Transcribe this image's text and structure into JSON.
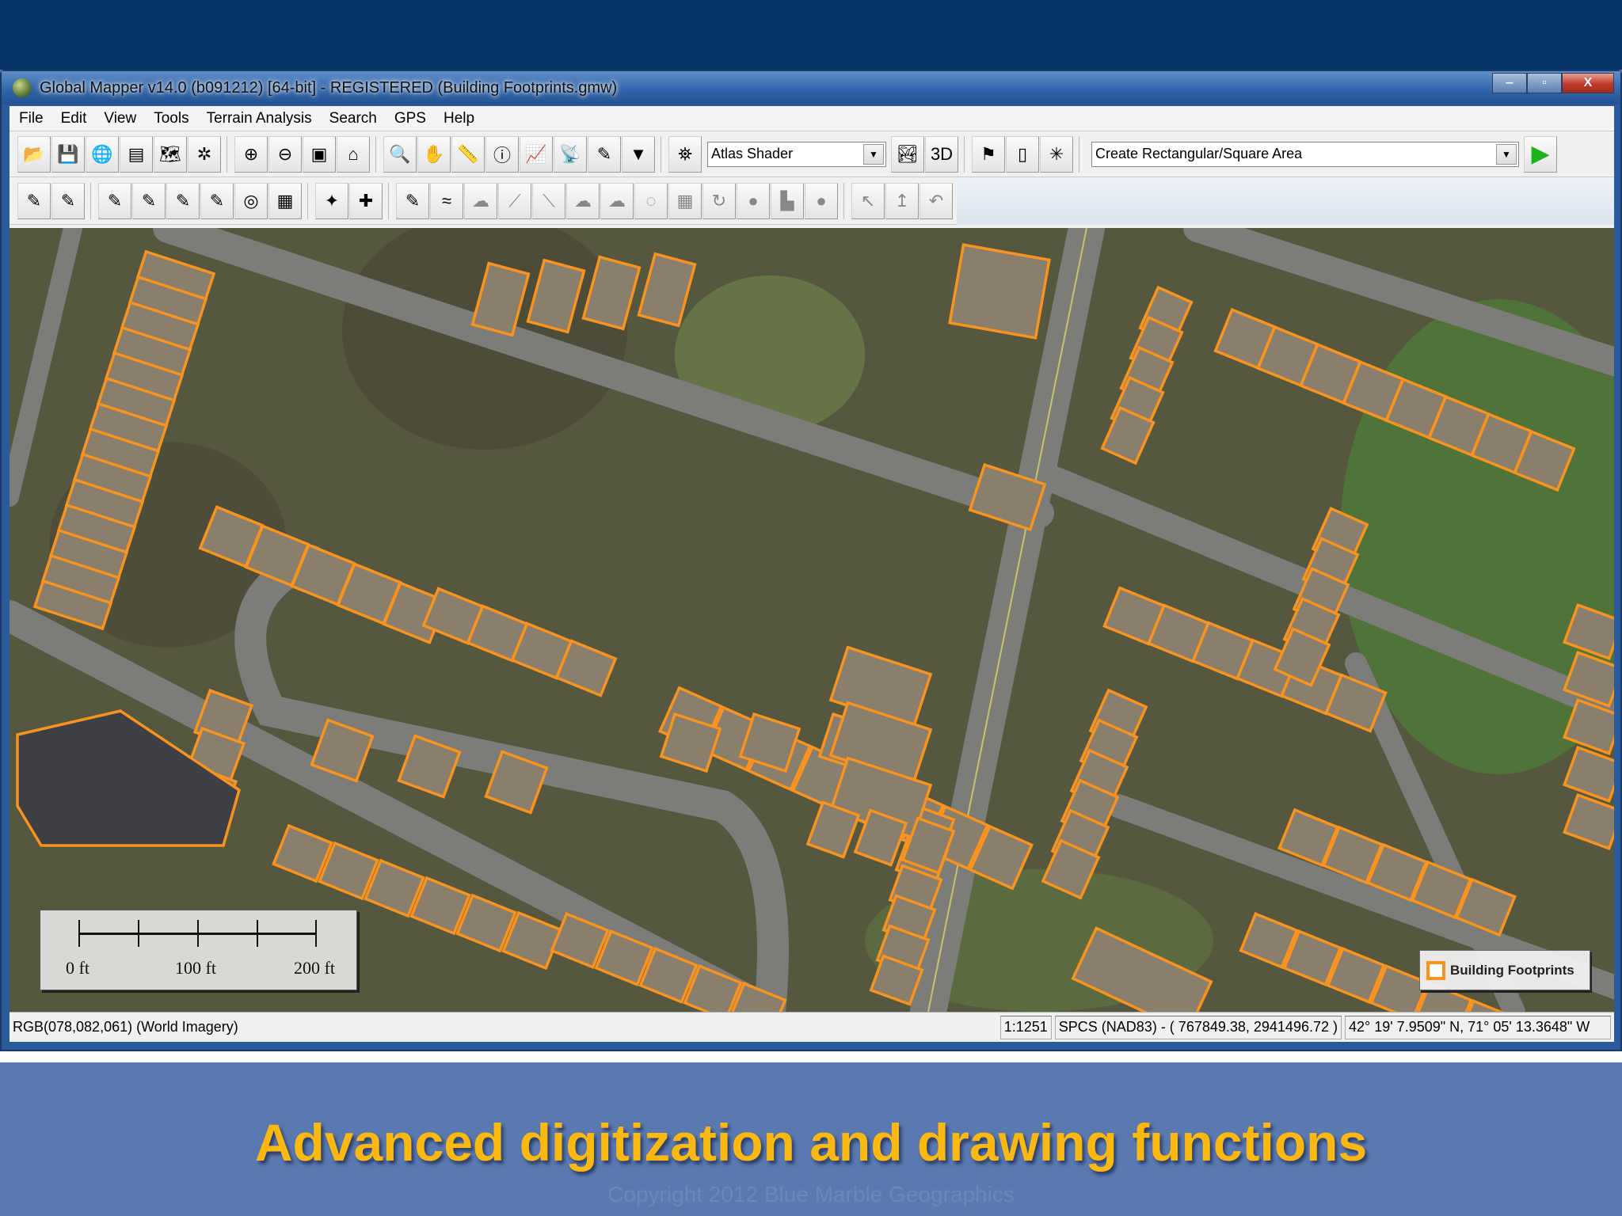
{
  "window": {
    "title": "Global Mapper v14.0 (b091212) [64-bit] - REGISTERED (Building Footprints.gmw)",
    "minimize": "‒",
    "maximize": "▫",
    "close": "X"
  },
  "menu": [
    "File",
    "Edit",
    "View",
    "Tools",
    "Terrain Analysis",
    "Search",
    "GPS",
    "Help"
  ],
  "toolbar1": {
    "group1": [
      {
        "icon": "open-folder-icon",
        "glyph": "📂"
      },
      {
        "icon": "save-icon",
        "glyph": "💾"
      },
      {
        "icon": "globe-icon",
        "glyph": "🌐"
      },
      {
        "icon": "control-center-icon",
        "glyph": "▤"
      },
      {
        "icon": "config-icon",
        "glyph": "🗺"
      },
      {
        "icon": "tools-icon",
        "glyph": "✲"
      }
    ],
    "group2": [
      {
        "icon": "zoom-in-icon",
        "glyph": "⊕"
      },
      {
        "icon": "zoom-out-icon",
        "glyph": "⊖"
      },
      {
        "icon": "zoom-to-layer-icon",
        "glyph": "▣"
      },
      {
        "icon": "home-icon",
        "glyph": "⌂"
      }
    ],
    "group3": [
      {
        "icon": "zoom-tool-icon",
        "glyph": "🔍"
      },
      {
        "icon": "pan-hand-icon",
        "glyph": "✋"
      },
      {
        "icon": "measure-icon",
        "glyph": "📏"
      },
      {
        "icon": "feature-info-icon",
        "glyph": "ⓘ"
      },
      {
        "icon": "path-profile-icon",
        "glyph": "📈"
      },
      {
        "icon": "view-shed-icon",
        "glyph": "📡"
      },
      {
        "icon": "digitizer-icon",
        "glyph": "✎"
      },
      {
        "icon": "filter-icon",
        "glyph": "▼"
      }
    ],
    "group4": [
      {
        "icon": "binoculars-icon",
        "glyph": "⛯"
      }
    ],
    "shader_select": "Atlas Shader",
    "group5": [
      {
        "icon": "3d-view-icon",
        "glyph": "🏞"
      },
      {
        "icon": "3d-icon",
        "glyph": "3D"
      }
    ],
    "group6": [
      {
        "icon": "gps-flag-icon",
        "glyph": "⚑"
      },
      {
        "icon": "gps-device-icon",
        "glyph": "▯"
      },
      {
        "icon": "gps-track-icon",
        "glyph": "✳"
      }
    ],
    "digitizer_mode_select": "Create Rectangular/Square Area",
    "go": "▶"
  },
  "toolbar2": [
    {
      "icon": "create-area-icon",
      "glyph": "✎"
    },
    {
      "icon": "create-line-icon",
      "glyph": "✎"
    },
    {
      "sep": true
    },
    {
      "icon": "create-stairs-icon",
      "glyph": "✎"
    },
    {
      "icon": "create-freehand-area-icon",
      "glyph": "✎"
    },
    {
      "icon": "create-rectangle-icon",
      "glyph": "✎"
    },
    {
      "icon": "create-range-ring-icon",
      "glyph": "✎"
    },
    {
      "icon": "create-circles-icon",
      "glyph": "◎"
    },
    {
      "icon": "create-grid-icon",
      "glyph": "▦"
    },
    {
      "sep": true
    },
    {
      "icon": "create-points-icon",
      "glyph": "✦"
    },
    {
      "icon": "create-line-point-icon",
      "glyph": "✚"
    },
    {
      "sep": true
    },
    {
      "icon": "edit-vertices-icon",
      "glyph": "✎"
    },
    {
      "icon": "smooth-line-icon",
      "glyph": "≈"
    },
    {
      "icon": "merge-areas-icon",
      "glyph": "☁",
      "gray": true
    },
    {
      "icon": "split-line-icon",
      "glyph": "⟋",
      "gray": true
    },
    {
      "icon": "join-line-icon",
      "glyph": "⟍",
      "gray": true
    },
    {
      "icon": "crop-area-icon",
      "glyph": "☁",
      "gray": true
    },
    {
      "icon": "combine-area-icon",
      "glyph": "☁",
      "gray": true
    },
    {
      "icon": "buffer-icon",
      "glyph": "◌",
      "gray": true
    },
    {
      "icon": "grid-area-icon",
      "glyph": "▦",
      "gray": true
    },
    {
      "icon": "rotate-area-icon",
      "glyph": "↻",
      "gray": true
    },
    {
      "icon": "fill-area-icon",
      "glyph": "●",
      "gray": true
    },
    {
      "icon": "dissolve-icon",
      "glyph": "▙",
      "gray": true
    },
    {
      "icon": "erase-area-icon",
      "glyph": "●",
      "gray": true
    },
    {
      "sep": true
    },
    {
      "icon": "move-vertex-icon",
      "glyph": "↖",
      "gray": true
    },
    {
      "icon": "extend-line-icon",
      "glyph": "↥",
      "gray": true
    },
    {
      "icon": "undo-icon",
      "glyph": "↶",
      "gray": true
    }
  ],
  "map": {
    "scale_bar": {
      "labels": [
        "0 ft",
        "100 ft",
        "200 ft"
      ]
    },
    "legend": {
      "label": "Building Footprints",
      "color": "#f7931e"
    }
  },
  "status": {
    "pixel_info": "RGB(078,082,061) (World Imagery)",
    "scale": "1:1251",
    "projected_coords": "SPCS (NAD83) - ( 767849.38, 2941496.72 )",
    "geo_coords": "42° 19' 7.9509\" N, 71° 05' 13.3648\" W"
  },
  "slide": {
    "caption": "Advanced digitization and drawing functions",
    "copyright": "Copyright 2012 Blue Marble Geographics"
  }
}
